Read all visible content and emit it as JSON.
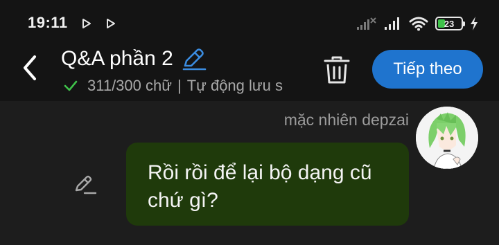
{
  "status_bar": {
    "time": "19:11",
    "battery_level": "23",
    "icons": [
      "play-store-icon",
      "play-store-icon",
      "signal-x-icon",
      "signal-icon",
      "wifi-icon",
      "battery-icon",
      "charging-icon"
    ]
  },
  "header": {
    "title": "Q&A phần 2",
    "word_count": "311/300 chữ",
    "autosave_text": "Tự động lưu s",
    "next_label": "Tiếp theo"
  },
  "message": {
    "author": "mặc nhiên depzai",
    "line1": "Rồi rồi để lại bộ dạng cũ",
    "line2": "chứ gì?"
  },
  "colors": {
    "background": "#1d1d1d",
    "topbar": "#141414",
    "accent": "#1f74ce",
    "bubble": "#1f3a0b",
    "check": "#3fc24a",
    "edit_icon": "#3b8ce0"
  }
}
